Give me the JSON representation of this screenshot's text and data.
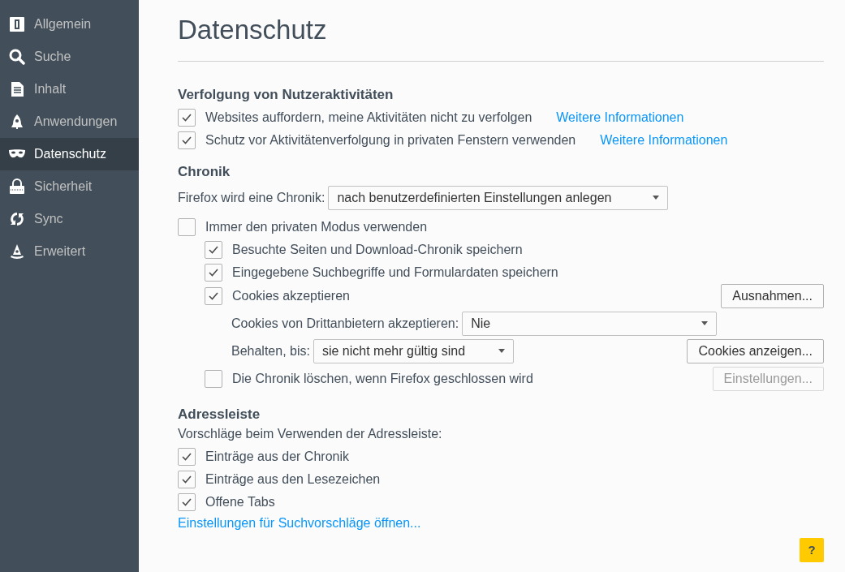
{
  "sidebar": {
    "items": [
      {
        "label": "Allgemein",
        "selected": false
      },
      {
        "label": "Suche",
        "selected": false
      },
      {
        "label": "Inhalt",
        "selected": false
      },
      {
        "label": "Anwendungen",
        "selected": false
      },
      {
        "label": "Datenschutz",
        "selected": true
      },
      {
        "label": "Sicherheit",
        "selected": false
      },
      {
        "label": "Sync",
        "selected": false
      },
      {
        "label": "Erweitert",
        "selected": false
      }
    ]
  },
  "title": "Datenschutz",
  "tracking": {
    "heading": "Verfolgung von Nutzeraktivitäten",
    "options": [
      {
        "label": "Websites auffordern, meine Aktivitäten nicht zu verfolgen",
        "checked": true,
        "link": "Weitere Informationen"
      },
      {
        "label": "Schutz vor Aktivitätenverfolgung in privaten Fenstern verwenden",
        "checked": true,
        "link": "Weitere Informationen"
      }
    ]
  },
  "history": {
    "heading": "Chronik",
    "mode_label": "Firefox wird eine Chronik:",
    "mode_value": "nach benutzerdefinierten Einstellungen anlegen",
    "private_mode": {
      "label": "Immer den privaten Modus verwenden",
      "checked": false
    },
    "options": [
      {
        "label": "Besuchte Seiten und Download-Chronik speichern",
        "checked": true
      },
      {
        "label": "Eingegebene Suchbegriffe und Formulardaten speichern",
        "checked": true
      }
    ],
    "cookies": {
      "label": "Cookies akzeptieren",
      "checked": true,
      "button": "Ausnahmen..."
    },
    "third_party_label": "Cookies von Drittanbietern akzeptieren:",
    "third_party_value": "Nie",
    "keep_label": "Behalten, bis:",
    "keep_value": "sie nicht mehr gültig sind",
    "show_cookies_button": "Cookies anzeigen...",
    "clear_on_close": {
      "label": "Die Chronik löschen, wenn Firefox geschlossen wird",
      "checked": false,
      "button": "Einstellungen...",
      "button_disabled": true
    }
  },
  "address_bar": {
    "heading": "Adressleiste",
    "subtitle": "Vorschläge beim Verwenden der Adressleiste:",
    "options": [
      {
        "label": "Einträge aus der Chronik",
        "checked": true
      },
      {
        "label": "Einträge aus den Lesezeichen",
        "checked": true
      },
      {
        "label": "Offene Tabs",
        "checked": true
      }
    ],
    "link": "Einstellungen für Suchvorschläge öffnen..."
  },
  "help_button": "?"
}
